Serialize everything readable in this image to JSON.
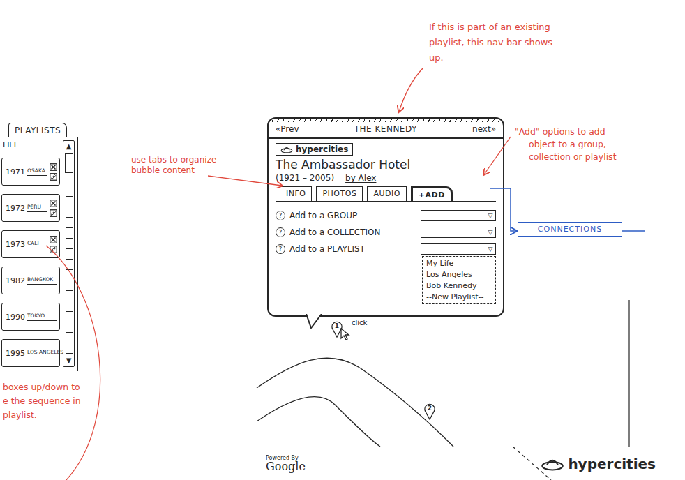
{
  "playlists": {
    "tab": "PLAYLISTS",
    "title": "LIFE",
    "scroll_up": "▲",
    "scroll_down": "▼",
    "items": [
      {
        "year": "1971",
        "place": "OSAKA",
        "kind": "editable"
      },
      {
        "year": "1972",
        "place": "PERU",
        "kind": "editable"
      },
      {
        "year": "1973",
        "place": "CALI",
        "kind": "editable"
      },
      {
        "year": "1982",
        "place": "BANGKOK",
        "kind": "plain"
      },
      {
        "year": "1990",
        "place": "TOKYO",
        "kind": "plain"
      },
      {
        "year": "1995",
        "place": "LOS ANGELES",
        "kind": "plain"
      }
    ],
    "note": [
      "boxes up/down to",
      "e the sequence in",
      "playlist."
    ]
  },
  "bubble": {
    "nav": {
      "prev": "«Prev",
      "title": "THE KENNEDY",
      "next": "next»"
    },
    "logo": "hypercities",
    "title": "The Ambassador Hotel",
    "dates": "(1921 – 2005)",
    "byline": "by Alex",
    "tabs": [
      {
        "label": "INFO",
        "selected": false
      },
      {
        "label": "PHOTOS",
        "selected": false
      },
      {
        "label": "AUDIO",
        "selected": false
      },
      {
        "label": "+ADD",
        "selected": true
      }
    ],
    "add_rows": [
      {
        "help": "?",
        "label": "Add to a GROUP",
        "arrow": "▽",
        "open": false
      },
      {
        "help": "?",
        "label": "Add to a COLLECTION",
        "arrow": "▽",
        "open": false
      },
      {
        "help": "?",
        "label": "Add to a PLAYLIST",
        "arrow": "▽",
        "open": true
      }
    ],
    "playlist_options": [
      "My Life",
      "Los Angeles",
      "Bob Kennedy",
      "--New Playlist--"
    ]
  },
  "map": {
    "pins": [
      {
        "label": "1",
        "clicked": true,
        "cursor_label": "click"
      },
      {
        "label": "2",
        "clicked": false,
        "cursor_label": ""
      }
    ],
    "credit": "Powered By",
    "credit_brand": "Google",
    "logo": "hypercities"
  },
  "annotations": {
    "navbar": [
      "If this is part of an existing",
      "playlist, this nav-bar shows",
      "up."
    ],
    "tabs": [
      "use tabs to organize",
      "bubble content"
    ],
    "add": [
      "\"Add\" options to add",
      "object to a group,",
      "collection or playlist"
    ],
    "connections": "CONNECTIONS"
  }
}
